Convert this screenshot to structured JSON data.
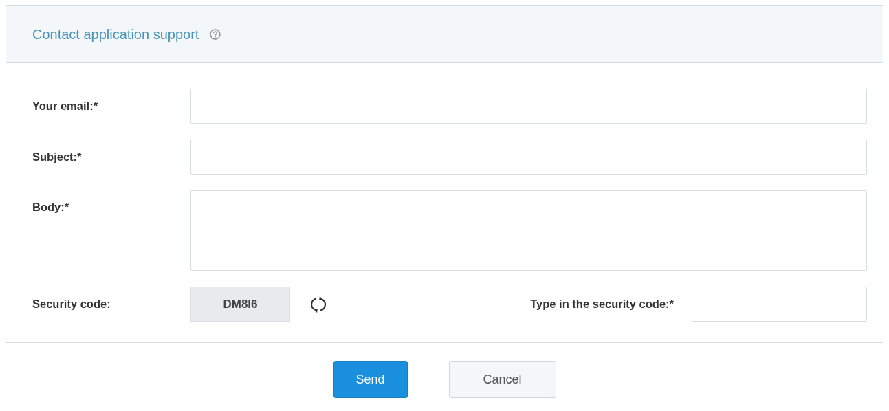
{
  "dialog": {
    "title": "Contact application support"
  },
  "fields": [
    {
      "kind": "input",
      "label": "Your email:*"
    },
    {
      "kind": "input",
      "label": "Subject:*"
    },
    {
      "kind": "textarea",
      "label": "Body:*"
    }
  ],
  "captcha": {
    "label": "Security code:",
    "code": "DM8I6",
    "input_label": "Type in the security code:*"
  },
  "buttons": [
    {
      "label": "Send",
      "kind": "primary"
    },
    {
      "label": "Cancel",
      "kind": "secondary"
    }
  ]
}
